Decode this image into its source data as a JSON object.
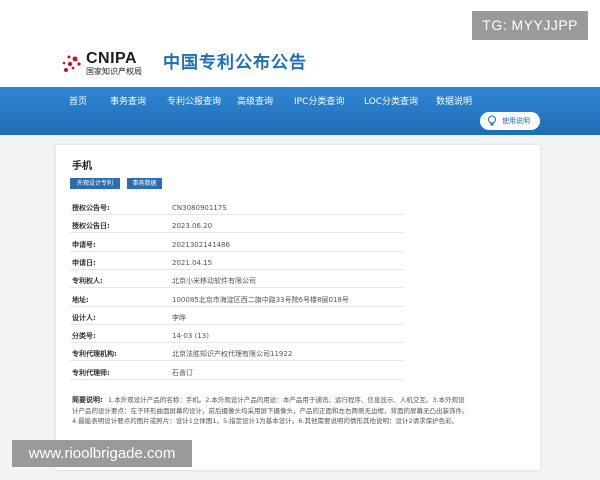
{
  "watermark_top": "TG: MYYJJPP",
  "watermark_bottom": "www.rioolbrigade.com",
  "logo": {
    "en": "CNIPA",
    "cn": "国家知识产权局"
  },
  "site_title": "中国专利公布公告",
  "nav": {
    "items": [
      "首页",
      "高级查询",
      "专利公报查询",
      "事务查询",
      "IPC分类查询",
      "LOC分类查询",
      "数据说明"
    ],
    "help": "使用说明"
  },
  "card": {
    "title": "手机",
    "tags": [
      "外观设计专利",
      "事务数据"
    ],
    "rows": [
      {
        "label": "授权公告号:",
        "value": "CN308090117S"
      },
      {
        "label": "授权公告日:",
        "value": "2023.06.20"
      },
      {
        "label": "申请号:",
        "value": "2021302141486"
      },
      {
        "label": "申请日:",
        "value": "2021.04.15"
      },
      {
        "label": "专利权人:",
        "value": "北京小米移动软件有限公司"
      },
      {
        "label": "地址:",
        "value": "100085北京市海淀区西二旗中路33号院6号楼8层018号"
      },
      {
        "label": "设计人:",
        "value": "李晔"
      },
      {
        "label": "分类号:",
        "value": "14-03 (13)"
      },
      {
        "label": "专利代理机构:",
        "value": "北京法胜知识产权代理有限公司11922"
      },
      {
        "label": "专利代理师:",
        "value": "石善订"
      }
    ],
    "brief_label": "简要说明:",
    "brief_text": "1.本外观设计产品的名称：手机。2.本外观设计产品的用途：本产品用于通讯、运行程序、信息显示、人机交互。3.本外观设计产品的设计要点：在于环形曲面屏幕的设计，前后摄像头均采用屏下摄像头，产品的正面和左右两侧无边框，背面的屏幕无凸出装饰件。4.最能表明设计要点的图片或照片：设计1立体图1。5.指定设计1为基本设计。6.其他需要说明的情形其他说明：设计2请求保护色彩。"
  },
  "colors": {
    "nav": "#1f6db8",
    "title": "#1f6fb3",
    "tag": "#2a6db5"
  }
}
